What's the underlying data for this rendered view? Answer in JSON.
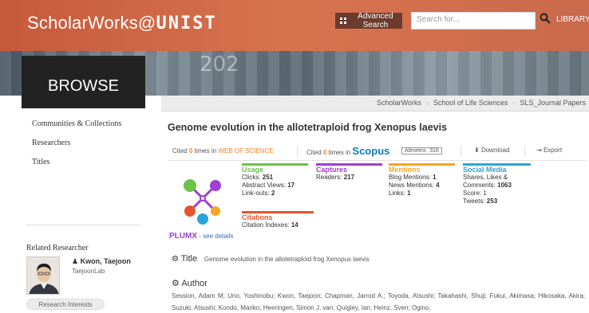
{
  "header": {
    "logo_main": "ScholarWorks@",
    "logo_unist": "UNIST",
    "advanced_search": "Advanced Search",
    "search_placeholder": "Search for...",
    "library": "LIBRARY"
  },
  "banner": {
    "text": "202"
  },
  "browse": "BROWSE",
  "breadcrumb": [
    "ScholarWorks",
    "School of Life Sciences",
    "SLS_Journal Papers"
  ],
  "sidebar": {
    "items": [
      "Communities & Collections",
      "Researchers",
      "Titles"
    ],
    "related_title": "Related Researcher",
    "researcher_name": "Kwon, Taejoon",
    "researcher_lab": "TaejoonLab",
    "research_interests": "Research Interests"
  },
  "main": {
    "title": "Genome evolution in the allotetraploid frog Xenopus laevis",
    "cite_wos_prefix": "Cited",
    "cite_wos_count": "0",
    "cite_wos_mid": "times in",
    "cite_wos_brand": "WEB OF SCIENCE",
    "cite_scopus_prefix": "Cited",
    "cite_scopus_count": "0",
    "cite_scopus_mid": "times in",
    "cite_scopus_brand": "Scopus",
    "altmetric_label": "Altmetric",
    "altmetric_score": "316",
    "download": "Download",
    "export": "Export"
  },
  "plumx": {
    "usage": {
      "title": "Usage",
      "lines": [
        "Clicks: ",
        "Abstract Views: ",
        "Link-outs: "
      ],
      "values": [
        "251",
        "17",
        "2"
      ]
    },
    "captures": {
      "title": "Captures",
      "lines": [
        "Readers: "
      ],
      "values": [
        "217"
      ]
    },
    "mentions": {
      "title": "Mentions",
      "lines": [
        "Blog Mentions: ",
        "News Mentions: ",
        "Links: "
      ],
      "values": [
        "1",
        "4",
        "1"
      ]
    },
    "social": {
      "title": "Social Media",
      "line1": "Shares, Likes &",
      "line2": "Comments: ",
      "comments": "1063",
      "line3": "Score: ",
      "score": "1",
      "line4": "Tweets: ",
      "tweets": "253"
    },
    "citations": {
      "title": "Citations",
      "line": "Citation Indexes: ",
      "value": "14"
    },
    "brand": "PLUMX",
    "see_details": "see details"
  },
  "record": {
    "title_label": "Title",
    "title_value": "Genome evolution in the allotetraploid frog Xenopus laevis",
    "author_label": "Author",
    "authors": "Session, Adam M; Uno, Yoshinobu; Kwon, Taejoon; Chapman, Jarrod A.; Toyoda, Atsushi; Takahashi, Shuji; Fukui, Akimasa; Hikosaka, Akira; Suzuki, Atsushi; Kondo, Mariko; Heeringen, Simon J. van; Quigley, Ian; Heinz, Sven; Ogino,"
  },
  "colors": {
    "header": "#c65a3c",
    "usage": "#6cc24a",
    "captures": "#a03fd0",
    "mentions": "#f5a623",
    "social": "#2ea3dc",
    "citations": "#e8542d"
  }
}
